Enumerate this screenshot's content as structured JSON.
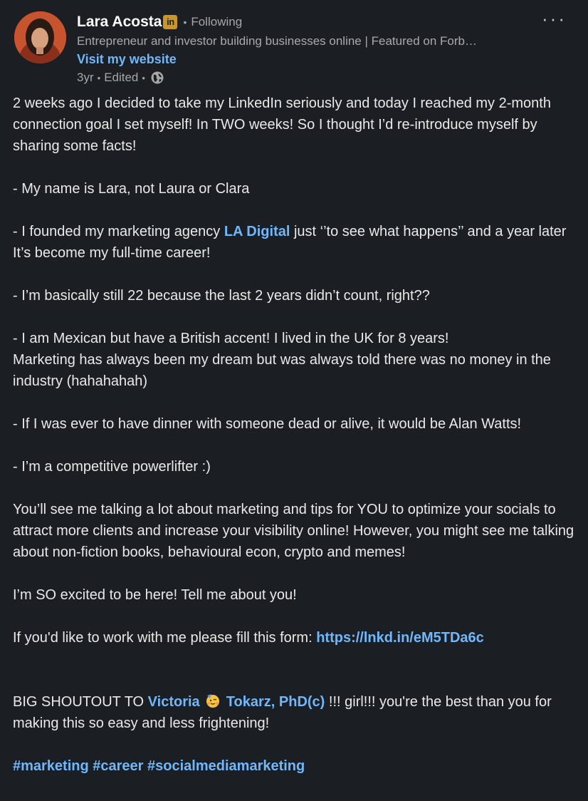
{
  "author": {
    "name": "Lara Acosta",
    "badge": "in",
    "follow_status": "Following",
    "headline": "Entrepreneur and investor building businesses online | Featured on Forb…",
    "website_label": "Visit my website",
    "time": "3yr",
    "edited": "Edited",
    "visibility_icon": "globe-icon"
  },
  "menu_icon": "more-horizontal-icon",
  "post": {
    "p1": "2 weeks ago I decided to take my LinkedIn seriously and today I reached my 2-month connection goal I set myself! In TWO weeks! So I thought I’d re-introduce myself by sharing some facts!",
    "p2": "- My name is Lara, not Laura or Clara",
    "p3_before": "- I founded my marketing agency ",
    "p3_link": "LA Digital",
    "p3_after": " just ‘’to see what happens’’ and a year later It’s become my full-time career!",
    "p4": "- I’m basically still 22 because the last 2 years didn’t count, right??",
    "p5a": "- I am Mexican but have a British accent! I lived in the UK for 8 years!",
    "p5b": "Marketing has always been my dream but was always told there was no money in the industry (hahahahah)",
    "p6": "- If I was ever to have dinner with someone dead or alive, it would be Alan Watts!",
    "p7": "- I’m a competitive powerlifter :)",
    "p8": "You’ll see me talking a lot about marketing and tips for YOU to optimize your socials to attract more clients and increase your visibility online! However, you might see me talking about non-fiction books, behavioural econ, crypto and memes!",
    "p9": "I’m SO excited to be here! Tell me about you!",
    "p10_before": "If you'd like to work with me please fill this form: ",
    "p10_link": "https://lnkd.in/eM5TDa6c",
    "p11_before": "BIG SHOUTOUT TO ",
    "p11_mention_first": "Victoria",
    "p11_emoji": "party-face-emoji",
    "p11_mention_last": "Tokarz, PhD(c)",
    "p11_after": " !!! girl!!! you're the best than you for making this so easy and less frightening!",
    "hashtags": [
      "#marketing",
      "#career",
      "#socialmediamarketing"
    ]
  },
  "colors": {
    "background": "#1b1f23",
    "link": "#71b7fb",
    "text": "#e9e9e9",
    "muted": "#a6a6a6",
    "badge": "#c9962c"
  }
}
